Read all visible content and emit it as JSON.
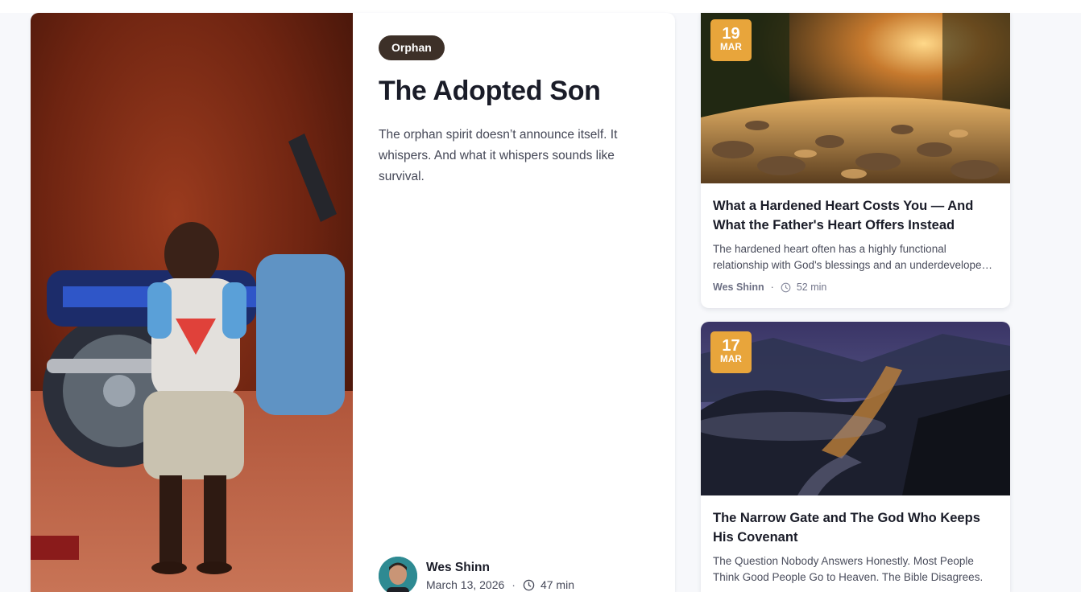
{
  "featured": {
    "category": "Orphan",
    "title": "The Adopted Son",
    "excerpt": "The orphan spirit doesn’t announce itself. It whispers. And what it whispers sounds like survival.",
    "author": "Wes Shinn",
    "date": "March 13, 2026",
    "separator": "·",
    "read_time": "47 min",
    "image_icon": "photo-child-with-motorcycle"
  },
  "side_posts": [
    {
      "day": "19",
      "month": "MAR",
      "title": "What a Hardened Heart Costs You — And What the Father's Heart Offers Instead",
      "excerpt": "The hardened heart often has a highly functional relationship with God's blessings and an underdeveloped relationship with the Father himself.",
      "author": "Wes Shinn",
      "separator": "·",
      "read_time": "52 min",
      "image_icon": "photo-rocky-stream-sunset"
    },
    {
      "day": "17",
      "month": "MAR",
      "title": "The Narrow Gate and The God Who Keeps His Covenant",
      "excerpt": "The Question Nobody Answers Honestly. Most People Think Good People Go to Heaven. The Bible Disagrees.",
      "image_icon": "photo-misty-mountain-valley"
    }
  ],
  "colors": {
    "badge": "#e8a53b",
    "pill": "#3d3028",
    "page_bg": "#f7f8fb"
  }
}
